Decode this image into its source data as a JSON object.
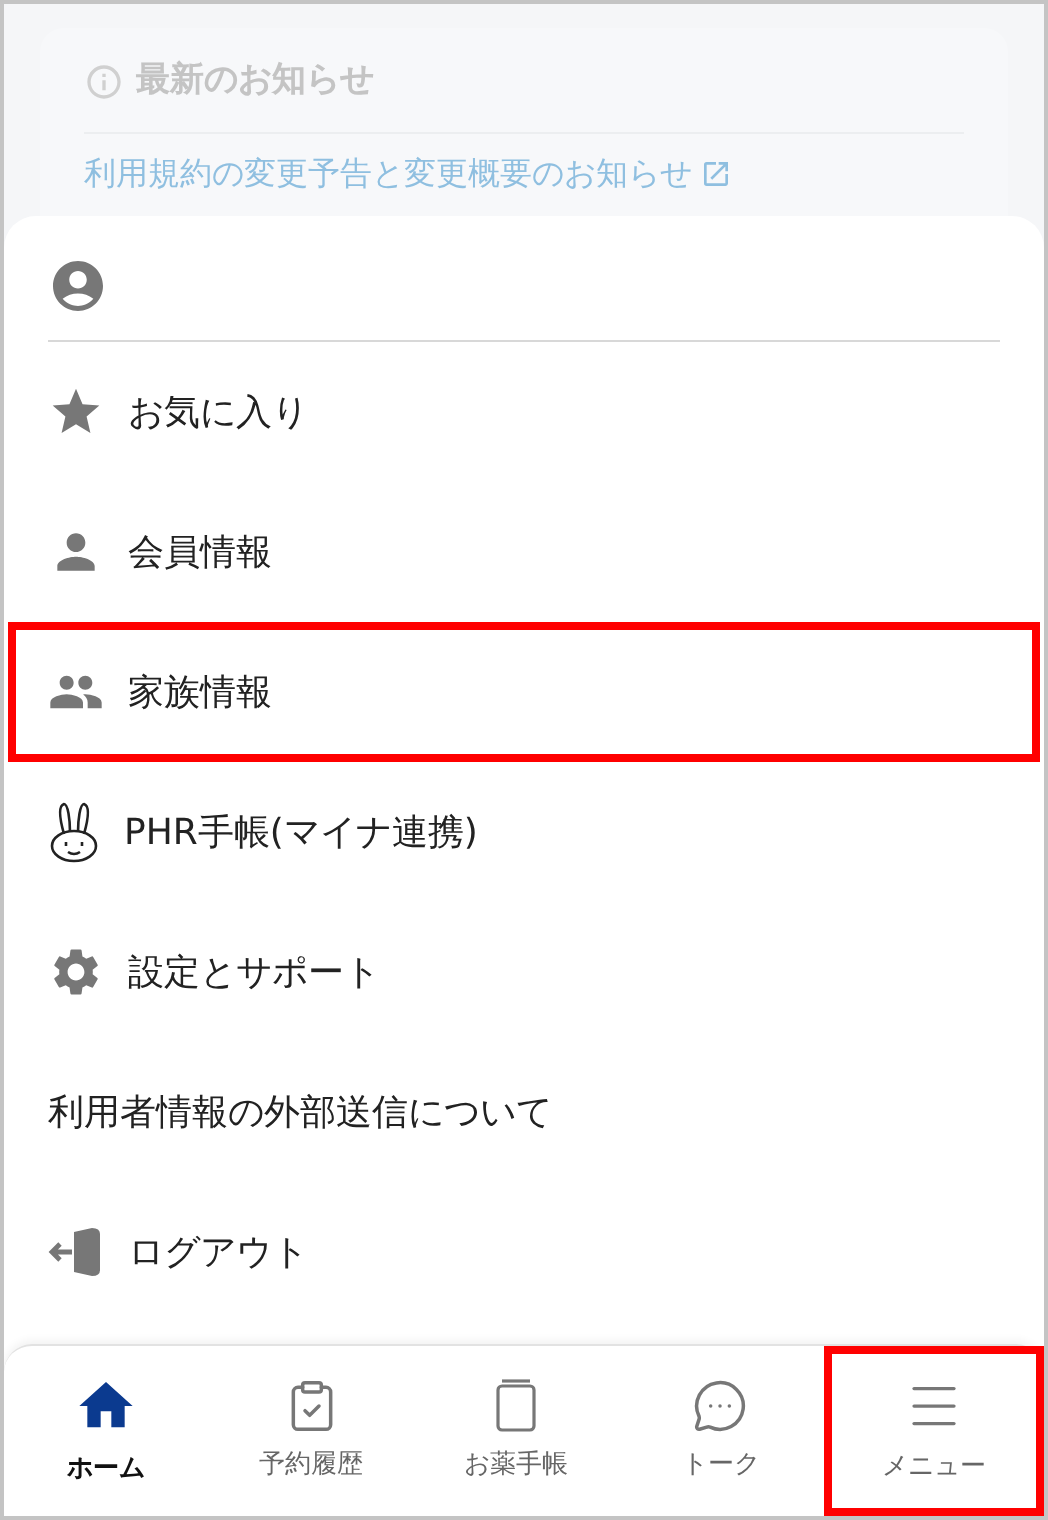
{
  "notice": {
    "title": "最新のお知らせ",
    "link": "利用規約の変更予告と変更概要のお知らせ"
  },
  "menu": [
    {
      "kind": "star",
      "label": "お気に入り",
      "highlighted": false
    },
    {
      "kind": "person",
      "label": "会員情報",
      "highlighted": false
    },
    {
      "kind": "family",
      "label": "家族情報",
      "highlighted": true
    },
    {
      "kind": "rabbit",
      "label": "PHR手帳(マイナ連携)",
      "highlighted": false
    },
    {
      "kind": "gear",
      "label": "設定とサポート",
      "highlighted": false
    },
    {
      "kind": "text",
      "label": "利用者情報の外部送信について",
      "highlighted": false
    },
    {
      "kind": "logout",
      "label": "ログアウト",
      "highlighted": false
    }
  ],
  "tabs": [
    {
      "kind": "home",
      "label": "ホーム",
      "selected": true,
      "highlighted": false
    },
    {
      "kind": "history",
      "label": "予約履歴",
      "selected": false,
      "highlighted": false
    },
    {
      "kind": "book",
      "label": "お薬手帳",
      "selected": false,
      "highlighted": false
    },
    {
      "kind": "chat",
      "label": "トーク",
      "selected": false,
      "highlighted": false
    },
    {
      "kind": "menu",
      "label": "メニュー",
      "selected": false,
      "highlighted": true
    }
  ]
}
